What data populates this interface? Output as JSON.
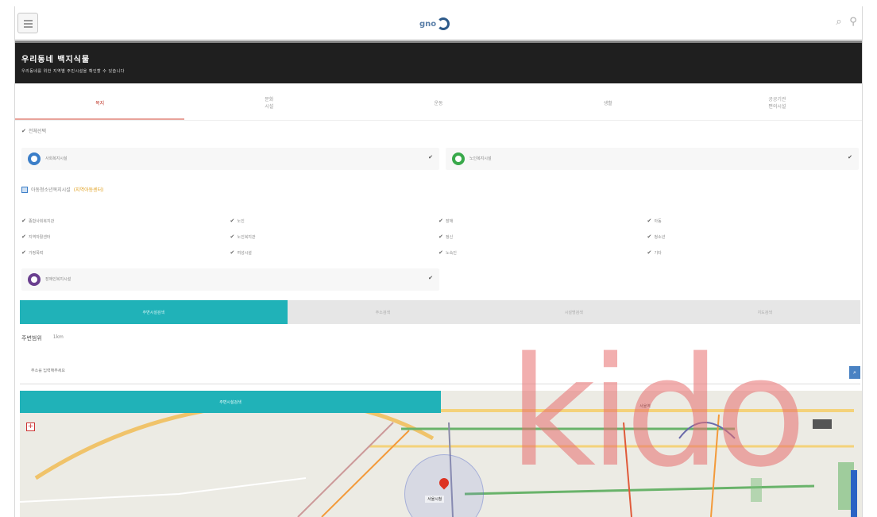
{
  "header": {
    "logo_text": "gno",
    "menu_icon": "hamburger-menu-icon",
    "search_icon": "search-icon",
    "user_icon": "user-icon"
  },
  "banner": {
    "title": "우리동네 백지식물",
    "subtitle": "우리동네를 위한 지역별 주민시설을 확인할 수 있습니다"
  },
  "main_tabs": [
    {
      "label": "복지",
      "active": true
    },
    {
      "label": "문화\n시설",
      "active": false
    },
    {
      "label": "운동",
      "active": false
    },
    {
      "label": "생활",
      "active": false
    },
    {
      "label": "공공기관\n편의시설",
      "active": false
    }
  ],
  "select_all": "전체선택",
  "panels": {
    "panel_1": {
      "label": "사회복지시설",
      "icon_color": "#3b7ec8"
    },
    "panel_2": {
      "label": "노인복지시설",
      "icon_color": "#39a94b"
    },
    "panel_3": {
      "label": "장애인복지시설",
      "icon_color": "#6a3f8f"
    }
  },
  "sub_select": {
    "label": "아동청소년복지시설",
    "note": "(지역아동센터)"
  },
  "grid_items": [
    "종합사회복지관",
    "노인",
    "장애",
    "아동",
    "지역자활센터",
    "노인복지관",
    "정신",
    "청소년",
    "가정폭력",
    "여성시설",
    "노숙인",
    "기타"
  ],
  "sub_tabs": [
    {
      "label": "주변시설검색",
      "active": true
    },
    {
      "label": "주소검색",
      "active": false
    },
    {
      "label": "시설명검색",
      "active": false
    },
    {
      "label": "지도검색",
      "active": false
    }
  ],
  "radius": {
    "label": "주변범위",
    "value": "1km"
  },
  "search": {
    "placeholder": "주소를 입력해주세요",
    "button": "검색"
  },
  "search_button": "주변시설검색",
  "map": {
    "location_label": "서울시청",
    "zoom_in": "+",
    "place_top": "서울역"
  },
  "watermark": "kido",
  "colors": {
    "teal": "#20b2b8",
    "banner": "#1f1f1f",
    "active_tab": "#c0392b",
    "watermark": "#e86e6e"
  }
}
